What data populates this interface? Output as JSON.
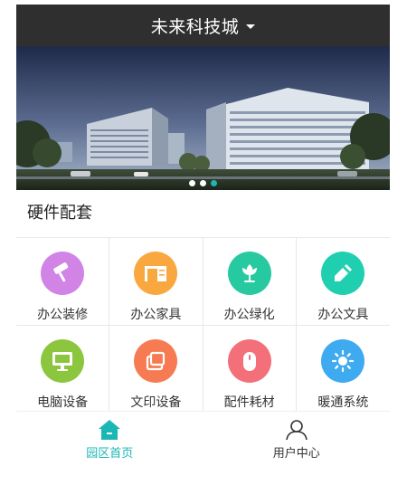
{
  "header": {
    "title": "未来科技城"
  },
  "banner": {
    "slide_count": 3,
    "active_slide": 3
  },
  "section": {
    "title": "硬件配套"
  },
  "services": [
    {
      "label": "办公装修",
      "icon": "paint-roller-icon",
      "color": "#d183e6"
    },
    {
      "label": "办公家具",
      "icon": "desk-icon",
      "color": "#f9a840"
    },
    {
      "label": "办公绿化",
      "icon": "flower-icon",
      "color": "#26c9a0"
    },
    {
      "label": "办公文具",
      "icon": "pencil-icon",
      "color": "#1fcfb0"
    },
    {
      "label": "电脑设备",
      "icon": "monitor-icon",
      "color": "#8cc63e"
    },
    {
      "label": "文印设备",
      "icon": "printer-icon",
      "color": "#f77b52"
    },
    {
      "label": "配件耗材",
      "icon": "mouse-icon",
      "color": "#f3707a"
    },
    {
      "label": "暖通系统",
      "icon": "sun-icon",
      "color": "#3eaaf0"
    }
  ],
  "tabbar": {
    "home": {
      "label": "园区首页",
      "icon": "home-icon",
      "color": "#1ab7b5"
    },
    "user": {
      "label": "用户中心",
      "icon": "user-icon",
      "color": "#333333"
    }
  }
}
